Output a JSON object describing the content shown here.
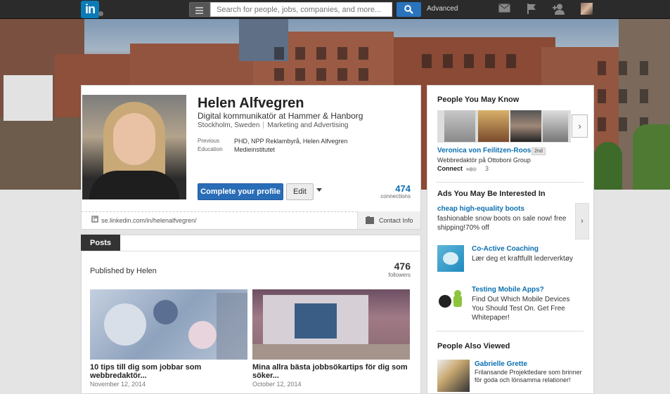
{
  "nav": {
    "search_placeholder": "Search for people, jobs, companies, and more...",
    "advanced_label": "Advanced",
    "logo_text": "in"
  },
  "profile": {
    "name": "Helen Alfvegren",
    "headline": "Digital kommunikatör at Hammer & Hanborg",
    "location": "Stockholm, Sweden",
    "industry": "Marketing and Advertising",
    "previous_label": "Previous",
    "previous_value": "PHD, NPP Reklambyrå, Helen Alfvegren",
    "education_label": "Education",
    "education_value": "Medieinstitutet",
    "complete_button": "Complete your profile",
    "edit_button": "Edit",
    "connections_count": "474",
    "connections_label": "connections",
    "public_url": "se.linkedin.com/in/helenalfvegren/",
    "contact_label": "Contact Info"
  },
  "posts": {
    "tab_label": "Posts",
    "published_by": "Published by Helen",
    "followers_count": "476",
    "followers_label": "followers",
    "items": [
      {
        "title": "10 tips till dig som jobbar som webbredaktör...",
        "date": "November 12, 2014"
      },
      {
        "title": "Mina allra bästa jobbsökartips för dig som söker...",
        "date": "October 12, 2014"
      }
    ]
  },
  "pymk": {
    "heading": "People You May Know",
    "name": "Veronica von Feilitzen-Roos",
    "degree": "2nd",
    "subtitle": "Webbredaktör på Ottoboni Group",
    "connect_label": "Connect",
    "shared_count": "3"
  },
  "ads": {
    "heading": "Ads You May Be Interested In",
    "items": [
      {
        "title": "cheap high-equality boots",
        "text": "fashionable snow boots on sale now! free shipping!70% off"
      },
      {
        "title": "Co-Active Coaching",
        "text": "Lær deg et kraftfullt lederverktøy"
      },
      {
        "title": "Testing Mobile Apps?",
        "text": "Find Out Which Mobile Devices You Should Test On. Get Free Whitepaper!"
      }
    ]
  },
  "also_viewed": {
    "heading": "People Also Viewed",
    "name": "Gabrielle Grette",
    "text": "Frilansande Projektledare som brinner för goda och lönsamma relationer!"
  }
}
